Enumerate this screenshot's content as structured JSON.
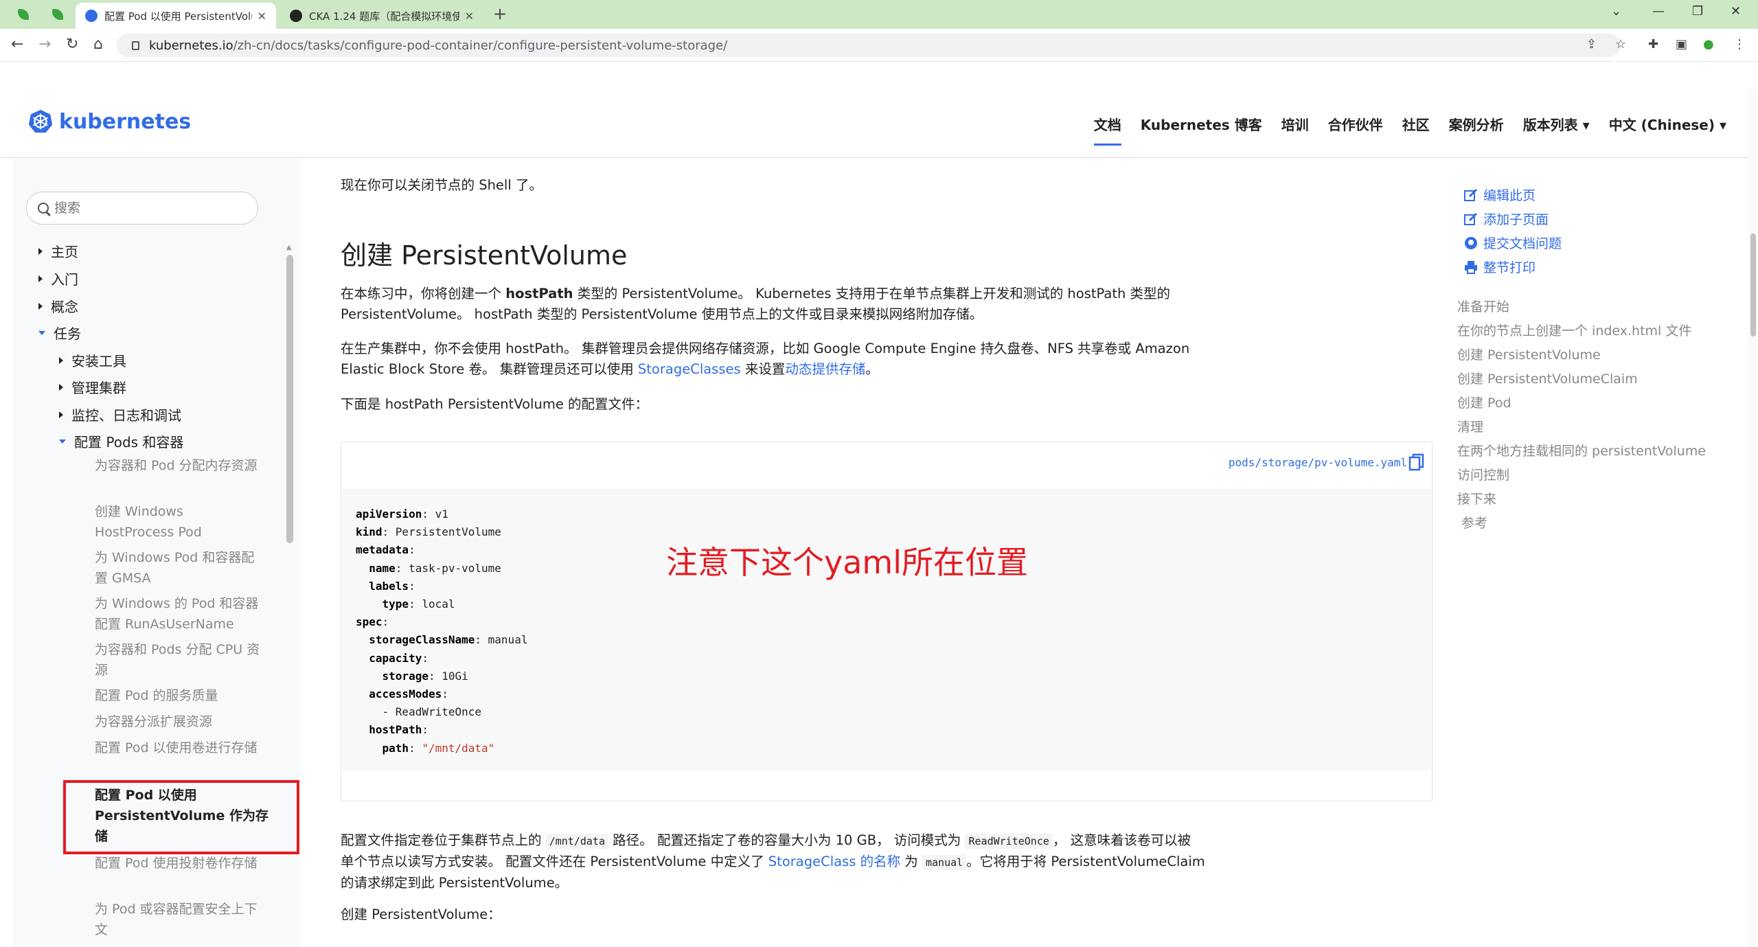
{
  "browser": {
    "tabs": [
      {
        "title": "配置 Pod 以使用 PersistentVolu",
        "active": true
      },
      {
        "title": "CKA 1.24 题库（配合模拟环境使",
        "active": false
      }
    ],
    "url_host": "kubernetes.io",
    "url_path": "/zh-cn/docs/tasks/configure-pod-container/configure-persistent-volume-storage/"
  },
  "site": {
    "logo_text": "kubernetes",
    "nav": [
      "文档",
      "Kubernetes 博客",
      "培训",
      "合作伙伴",
      "社区",
      "案例分析",
      "版本列表 ▾",
      "中文 (Chinese) ▾"
    ]
  },
  "sidebar": {
    "search_placeholder": "搜索",
    "top_items": [
      "主页",
      "入门",
      "概念",
      "任务"
    ],
    "task_items": [
      "安装工具",
      "管理集群",
      "监控、日志和调试",
      "配置 Pods 和容器"
    ],
    "sub_items": [
      "为容器和 Pod 分配内存资源",
      "创建 Windows HostProcess Pod",
      "为 Windows Pod 和容器配置 GMSA",
      "为 Windows 的 Pod 和容器配置 RunAsUserName",
      "为容器和 Pods 分配 CPU 资源",
      "配置 Pod 的服务质量",
      "为容器分派扩展资源",
      "配置 Pod 以使用卷进行存储",
      "配置 Pod 以使用 PersistentVolume 作为存储",
      "配置 Pod 使用投射卷作存储",
      "为 Pod 或容器配置安全上下文"
    ]
  },
  "main": {
    "intro": "现在你可以关闭节点的 Shell 了。",
    "heading": "创建 PersistentVolume",
    "para1_a": "在本练习中，你将创建一个 ",
    "para1_b": "hostPath",
    "para1_c": " 类型的 PersistentVolume。 Kubernetes 支持用于在单节点集群上开发和测试的 hostPath 类型的",
    "para1_d": "PersistentVolume。 hostPath 类型的 PersistentVolume 使用节点上的文件或目录来模拟网络附加存储。",
    "para2_a": "在生产集群中，你不会使用 hostPath。 集群管理员会提供网络存储资源，比如 Google Compute Engine 持久盘卷、NFS 共享卷或 Amazon",
    "para2_b": "Elastic Block Store 卷。 集群管理员还可以使用 ",
    "para2_link1": "StorageClasses",
    "para2_c": " 来设置",
    "para2_link2": "动态提供存储",
    "para2_d": "。",
    "para3": "下面是 hostPath PersistentVolume 的配置文件：",
    "file_link": "pods/storage/pv-volume.yaml",
    "yaml": [
      {
        "indent": 0,
        "key": "apiVersion",
        "value": "v1",
        "str": false
      },
      {
        "indent": 0,
        "key": "kind",
        "value": "PersistentVolume",
        "str": false
      },
      {
        "indent": 0,
        "key": "metadata",
        "value": "",
        "str": false
      },
      {
        "indent": 1,
        "key": "name",
        "value": "task-pv-volume",
        "str": false
      },
      {
        "indent": 1,
        "key": "labels",
        "value": "",
        "str": false
      },
      {
        "indent": 2,
        "key": "type",
        "value": "local",
        "str": false
      },
      {
        "indent": 0,
        "key": "spec",
        "value": "",
        "str": false
      },
      {
        "indent": 1,
        "key": "storageClassName",
        "value": "manual",
        "str": false
      },
      {
        "indent": 1,
        "key": "capacity",
        "value": "",
        "str": false
      },
      {
        "indent": 2,
        "key": "storage",
        "value": "10Gi",
        "str": false
      },
      {
        "indent": 1,
        "key": "accessModes",
        "value": "",
        "str": false
      },
      {
        "indent": 2,
        "key": "",
        "value": "- ReadWriteOnce",
        "str": false
      },
      {
        "indent": 1,
        "key": "hostPath",
        "value": "",
        "str": false
      },
      {
        "indent": 2,
        "key": "path",
        "value": "\"/mnt/data\"",
        "str": true
      }
    ],
    "annotation": "注意下这个yaml所在位置",
    "para4_a": "配置文件指定卷位于集群节点上的 ",
    "para4_code1": "/mnt/data",
    "para4_b": " 路径。 配置还指定了卷的容量大小为 10 GB， 访问模式为 ",
    "para4_code2": "ReadWriteOnce",
    "para4_c": "， 这意味着该卷可以被",
    "para4_d": "单个节点以读写方式安装。 配置文件还在 PersistentVolume 中定义了 ",
    "para4_link": "StorageClass 的名称",
    "para4_e": " 为 ",
    "para4_code3": "manual",
    "para4_f": "。它将用于将 PersistentVolumeClaim",
    "para4_g": "的请求绑定到此 PersistentVolume。",
    "para5": "创建 PersistentVolume："
  },
  "toc": {
    "actions": [
      "编辑此页",
      "添加子页面",
      "提交文档问题",
      "整节打印"
    ],
    "items": [
      "准备开始",
      "在你的节点上创建一个 index.html 文件",
      "创建 PersistentVolume",
      "创建 PersistentVolumeClaim",
      "创建 Pod",
      "清理",
      "在两个地方挂载相同的 persistentVolume",
      "访问控制",
      "接下来",
      " 参考"
    ]
  },
  "colors": {
    "accent": "#326ce5",
    "annotation": "#e31c23",
    "tabbar": "#cde8c5"
  }
}
